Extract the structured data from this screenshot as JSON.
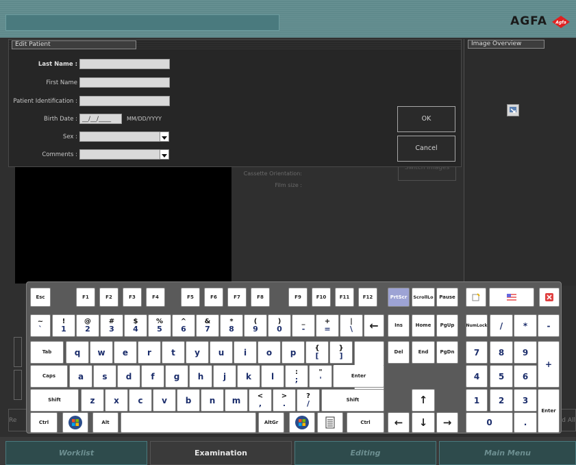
{
  "header": {
    "brand": "AGFA",
    "logo_text": "Agfa"
  },
  "edit_patient": {
    "title": "Edit Patient",
    "fields": [
      {
        "label": "Last Name :",
        "value": ""
      },
      {
        "label": "First Name",
        "value": ""
      },
      {
        "label": "Patient Identification :",
        "value": ""
      },
      {
        "label": "Birth Date :",
        "value": "__/__/____",
        "hint": "MM/DD/YYYY"
      },
      {
        "label": "Sex :",
        "value": ""
      },
      {
        "label": "Comments :",
        "value": ""
      }
    ],
    "ok_label": "OK",
    "cancel_label": "Cancel",
    "switch_images_label": "Switch Images"
  },
  "overview": {
    "title": "Image Overview"
  },
  "background_labels": {
    "cassette_orientation": "Cassette Orientation:",
    "film_size": "Film size :",
    "left_cut": "Re",
    "right_cut": "d All"
  },
  "keyboard": {
    "row0": [
      "Esc",
      "F1",
      "F2",
      "F3",
      "F4",
      "F5",
      "F6",
      "F7",
      "F8",
      "F9",
      "F10",
      "F11",
      "F12",
      "PrtScr",
      "ScrollLo",
      "Pause"
    ],
    "digits": [
      [
        "~",
        "`"
      ],
      [
        "!",
        "1"
      ],
      [
        "@",
        "2"
      ],
      [
        "#",
        "3"
      ],
      [
        "$",
        "4"
      ],
      [
        "%",
        "5"
      ],
      [
        "^",
        "6"
      ],
      [
        "&",
        "7"
      ],
      [
        "*",
        "8"
      ],
      [
        "(",
        "9"
      ],
      [
        ")",
        "0"
      ],
      [
        "_",
        "-"
      ],
      [
        "+",
        "="
      ],
      [
        "|",
        "\\"
      ]
    ],
    "backspace": "←",
    "tab": "Tab",
    "row_q": [
      "q",
      "w",
      "e",
      "r",
      "t",
      "y",
      "u",
      "i",
      "o",
      "p"
    ],
    "brackets": [
      [
        "{",
        "["
      ],
      [
        "}",
        "]"
      ]
    ],
    "caps": "Caps",
    "row_a": [
      "a",
      "s",
      "d",
      "f",
      "g",
      "h",
      "j",
      "k",
      "l"
    ],
    "semi": [
      ":",
      ";"
    ],
    "quote": [
      "\"",
      "'"
    ],
    "enter": "Enter",
    "shift": "Shift",
    "row_z": [
      "z",
      "x",
      "c",
      "v",
      "b",
      "n",
      "m"
    ],
    "punct": [
      [
        "<",
        ","
      ],
      [
        ">",
        "."
      ],
      [
        "?",
        "/"
      ]
    ],
    "ctrl": "Ctrl",
    "alt": "Alt",
    "altgr": "AltGr",
    "nav": [
      "Ins",
      "Home",
      "PgUp",
      "Del",
      "End",
      "PgDn"
    ],
    "numpad": [
      "NumLock",
      "/",
      "*",
      "-",
      "7",
      "8",
      "9",
      "+",
      "4",
      "5",
      "6",
      "1",
      "2",
      "3",
      "Enter",
      "0",
      "."
    ],
    "arrows": {
      "up": "↑",
      "down": "↓",
      "left": "←",
      "right": "→"
    }
  },
  "nav_tabs": [
    {
      "label": "Worklist"
    },
    {
      "label": "Examination"
    },
    {
      "label": "Editing"
    },
    {
      "label": "Main Menu"
    }
  ],
  "colors": {
    "accent_teal": "#5f8a8c",
    "key_active": "#9da3d4"
  }
}
